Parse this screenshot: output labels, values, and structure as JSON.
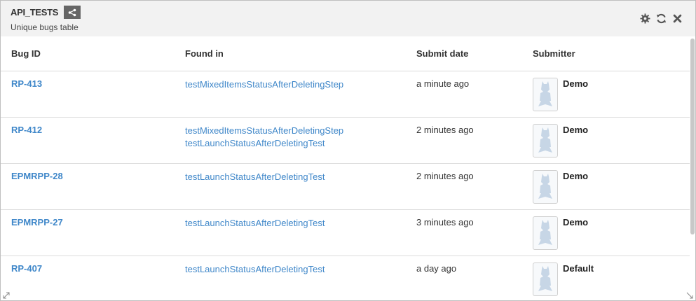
{
  "widget": {
    "title": "API_TESTS",
    "subtitle": "Unique bugs table"
  },
  "icons": {
    "share": "share-icon",
    "settings": "gear-icon",
    "refresh": "refresh-icon",
    "close": "close-icon"
  },
  "table": {
    "headers": {
      "bug_id": "Bug ID",
      "found_in": "Found in",
      "submit_date": "Submit date",
      "submitter": "Submitter"
    },
    "rows": [
      {
        "bug_id": "RP-413",
        "found_in": [
          "testMixedItemsStatusAfterDeletingStep"
        ],
        "submit_date": "a minute ago",
        "submitter": "Demo"
      },
      {
        "bug_id": "RP-412",
        "found_in": [
          "testMixedItemsStatusAfterDeletingStep",
          "testLaunchStatusAfterDeletingTest"
        ],
        "submit_date": "2 minutes ago",
        "submitter": "Demo"
      },
      {
        "bug_id": "EPMRPP-28",
        "found_in": [
          "testLaunchStatusAfterDeletingTest"
        ],
        "submit_date": "2 minutes ago",
        "submitter": "Demo"
      },
      {
        "bug_id": "EPMRPP-27",
        "found_in": [
          "testLaunchStatusAfterDeletingTest"
        ],
        "submit_date": "3 minutes ago",
        "submitter": "Demo"
      },
      {
        "bug_id": "RP-407",
        "found_in": [
          "testLaunchStatusAfterDeletingTest"
        ],
        "submit_date": "a day ago",
        "submitter": "Default"
      }
    ]
  },
  "colors": {
    "link": "#3f87c9",
    "header_bg": "#f2f2f2",
    "share_button_bg": "#666666"
  }
}
